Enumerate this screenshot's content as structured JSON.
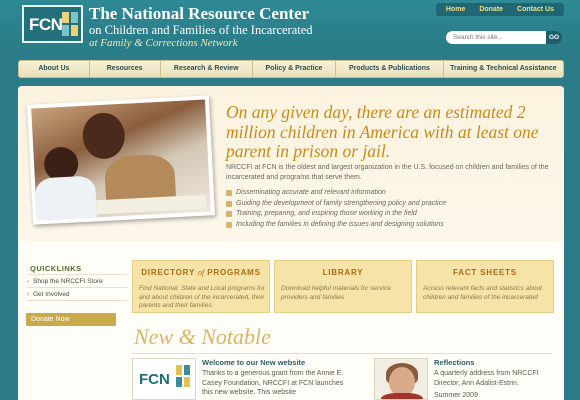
{
  "header": {
    "logo_text": "FCN",
    "org_line1": "The National Resource Center",
    "org_line2": "on Children and Families of the Incarcerated",
    "org_line3": "at Family & Corrections Network",
    "toplinks": [
      "Home",
      "Donate",
      "Contact Us"
    ],
    "search_placeholder": "Search this site...",
    "search_go": "GO"
  },
  "nav": {
    "items": [
      "About Us",
      "Resources",
      "Research & Review",
      "Policy & Practice",
      "Products & Publications",
      "Training & Technical Assistance"
    ]
  },
  "hero": {
    "headline": "On any given day, there are an estimated 2 million children in America with at least one parent in prison or jail.",
    "description": "NRCCFI at FCN is the oldest and largest organization in the U.S. focused on children and families of the incarcerated and programs that serve them.",
    "list": [
      "Disseminating accurate and relevant information",
      "Guiding the development of family strengthening policy and practice",
      "Training, preparing, and inspiring those working in the field",
      "Including the families in defining the issues and designing solutions"
    ]
  },
  "quicklinks": {
    "title": "QUICKLINKS",
    "items": [
      "Shop the NRCCFI Store",
      "Get Involved"
    ],
    "donate": "Donate Now"
  },
  "boxes": [
    {
      "title_a": "DIRECTORY",
      "title_of": "of",
      "title_b": "PROGRAMS",
      "desc": "Find National, State and Local programs for and about children of the incarcerated, their parents and their families."
    },
    {
      "title": "LIBRARY",
      "desc": "Download helpful materials for service providers and families"
    },
    {
      "title": "FACT SHEETS",
      "desc": "Access relevant facts and statistics about children and families of the incarcerated"
    }
  ],
  "news": {
    "heading": "New & Notable",
    "item1": {
      "logo_text": "FCN",
      "title": "Welcome to our New website",
      "body": "Thanks to a generous grant from the Annie E. Casey Foundation, NRCCFI at FCN launches this new website. This website"
    },
    "item2": {
      "title": "Reflections",
      "body": "A quarterly address from NRCCFI Director, Ann Adalist-Estrin.",
      "date": "Summer 2009"
    }
  },
  "colors": {
    "page_bg": "#2b7c88",
    "accent_gold": "#c98a1a",
    "box_bg": "#f6e3a8"
  }
}
